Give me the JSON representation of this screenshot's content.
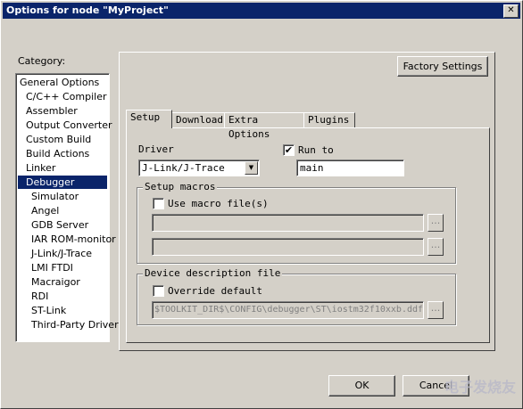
{
  "window": {
    "title": "Options for node \"MyProject\"",
    "close_glyph": "✕"
  },
  "category": {
    "label": "Category:",
    "items": [
      "General Options",
      "C/C++ Compiler",
      "Assembler",
      "Output Converter",
      "Custom Build",
      "Build Actions",
      "Linker",
      "Debugger",
      "Simulator",
      "Angel",
      "GDB Server",
      "IAR ROM-monitor",
      "J-Link/J-Trace",
      "LMI FTDI",
      "Macraigor",
      "RDI",
      "ST-Link",
      "Third-Party Driver"
    ],
    "selected": "Debugger"
  },
  "factory_settings": "Factory Settings",
  "tabs": [
    "Setup",
    "Download",
    "Extra Options",
    "Plugins"
  ],
  "setup": {
    "driver_label": "Driver",
    "driver_value": "J-Link/J-Trace",
    "run_to_label": "Run to",
    "run_to_checked": "✔",
    "run_to_value": "main",
    "setup_macros_label": "Setup macros",
    "use_macro_label": "Use macro file(s)",
    "ellipsis": "...",
    "device_desc_label": "Device description file",
    "override_label": "Override default",
    "device_file": "$TOOLKIT_DIR$\\CONFIG\\debugger\\ST\\iostm32f10xxb.ddf"
  },
  "ok_label": "OK",
  "cancel_label": "Cancel",
  "watermark": "电子发烧友"
}
